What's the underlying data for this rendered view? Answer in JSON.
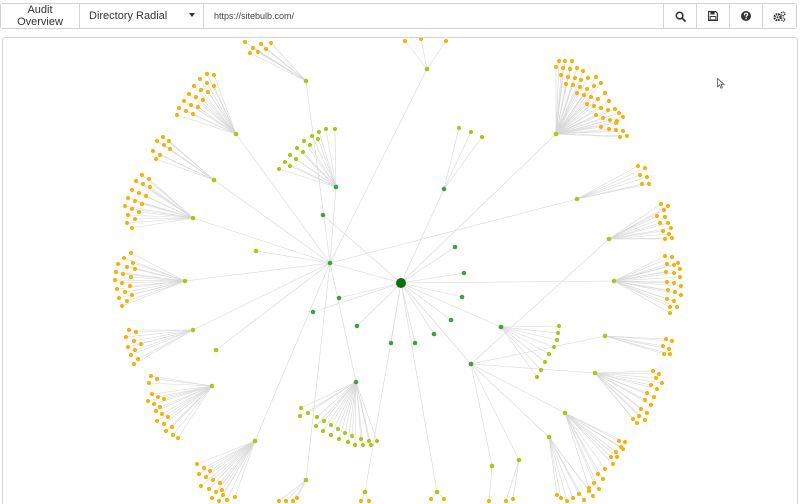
{
  "toolbar": {
    "audit_label": "Audit Overview",
    "view_select": "Directory Radial",
    "url_value": "https://sitebulb.com/",
    "icons": [
      "search-icon",
      "save-icon",
      "help-icon",
      "settings-icon"
    ]
  },
  "graph": {
    "type": "directory-radial",
    "colors": {
      "root": "#0d6d0f",
      "level1": "#3ea33e",
      "level2": "#a7c81a",
      "leaf": "#f2b30b",
      "edge": "#d7d7d7"
    }
  }
}
